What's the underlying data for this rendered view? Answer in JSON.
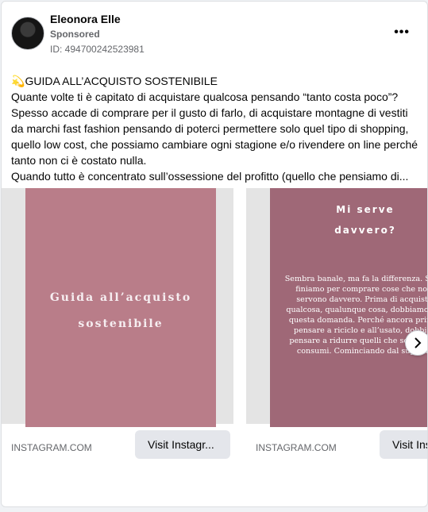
{
  "post": {
    "author": "Eleonora Elle",
    "sponsored": "Sponsored",
    "ad_id": "ID: 494700242523981",
    "more": "•••",
    "text_lines": [
      "GUIDA ALL’ACQUISTO SOSTENIBILE",
      "Quante volte ti è capitato di acquistare qualcosa pensando “tanto costa poco”?",
      "Spesso accade di comprare per il gusto di farlo, di acquistare montagne di vestiti",
      "da marchi fast fashion pensando di poterci permettere solo quel tipo di shopping,",
      "quello low cost, che possiamo cambiare ogni stagione e/o rivendere on line perché",
      "tanto non ci è costato nulla.",
      "Quando tutto è concentrato sull’ossessione del profitto (quello che pensiamo di..."
    ],
    "leading_icon": "dizzy-emoji-icon"
  },
  "carousel": {
    "slides": [
      {
        "title": "Guida all’acquisto sostenibile",
        "domain": "INSTAGRAM.COM",
        "cta": "Visit Instagr..."
      },
      {
        "title": "Mi serve davvero?",
        "paragraph": "Sembra banale, ma fa la differenza. Spesso finiamo per comprare cose che non ci servono davvero. Prima di acquistare qualcosa, qualunque cosa, dobbiamo porci questa domanda. Perché ancora prima di pensare a riciclo e all’usato, dobbiamo pensare a ridurre quelli che sono i nostri consumi. Cominciando dal superfluo.",
        "domain": "INSTAGRAM.COM",
        "cta": "Visit Ins"
      }
    ],
    "next_icon": "chevron-right-icon"
  },
  "colors": {
    "slide1_bg": "#b97d89",
    "slide2_bg": "#9f6877",
    "button_bg": "#e4e6eb"
  }
}
